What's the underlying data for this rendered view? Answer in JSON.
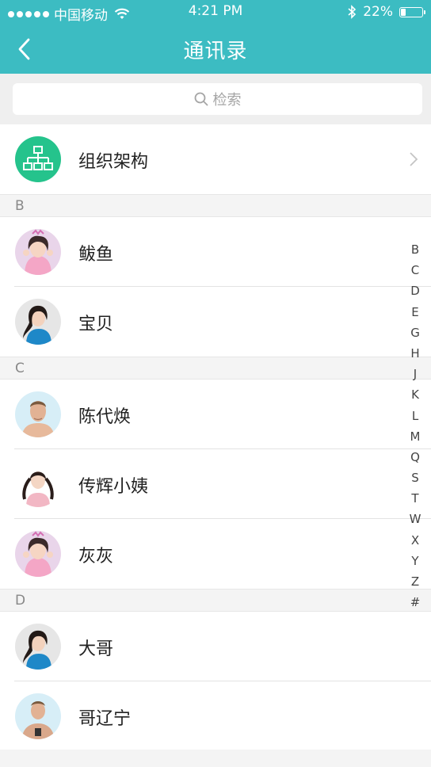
{
  "status_bar": {
    "carrier": "中国移动",
    "time": "4:21 PM",
    "battery": "22%",
    "battery_level": 0.22
  },
  "nav": {
    "title": "通讯录",
    "back_icon": "chevron-left-icon"
  },
  "search": {
    "placeholder": "检索",
    "icon": "search-icon"
  },
  "org": {
    "label": "组织架构",
    "icon": "org-chart-icon",
    "color": "#25c38c"
  },
  "sections": [
    {
      "letter": "B",
      "contacts": [
        {
          "name": "鲅鱼",
          "avatar": "avatar-pink-girl"
        },
        {
          "name": "宝贝",
          "avatar": "avatar-blue-girl"
        }
      ]
    },
    {
      "letter": "C",
      "contacts": [
        {
          "name": "陈代焕",
          "avatar": "avatar-man"
        },
        {
          "name": "传辉小姨",
          "avatar": "avatar-braids-girl"
        },
        {
          "name": "灰灰",
          "avatar": "avatar-pink-girl"
        }
      ]
    },
    {
      "letter": "D",
      "contacts": [
        {
          "name": "大哥",
          "avatar": "avatar-blue-girl"
        },
        {
          "name": "哥辽宁",
          "avatar": "avatar-man"
        }
      ]
    }
  ],
  "alphabet_index": [
    "B",
    "C",
    "D",
    "E",
    "G",
    "H",
    "J",
    "K",
    "L",
    "M",
    "Q",
    "S",
    "T",
    "W",
    "X",
    "Y",
    "Z",
    "#"
  ],
  "colors": {
    "accent": "#3cbcc2",
    "org_icon_bg": "#25c38c"
  }
}
